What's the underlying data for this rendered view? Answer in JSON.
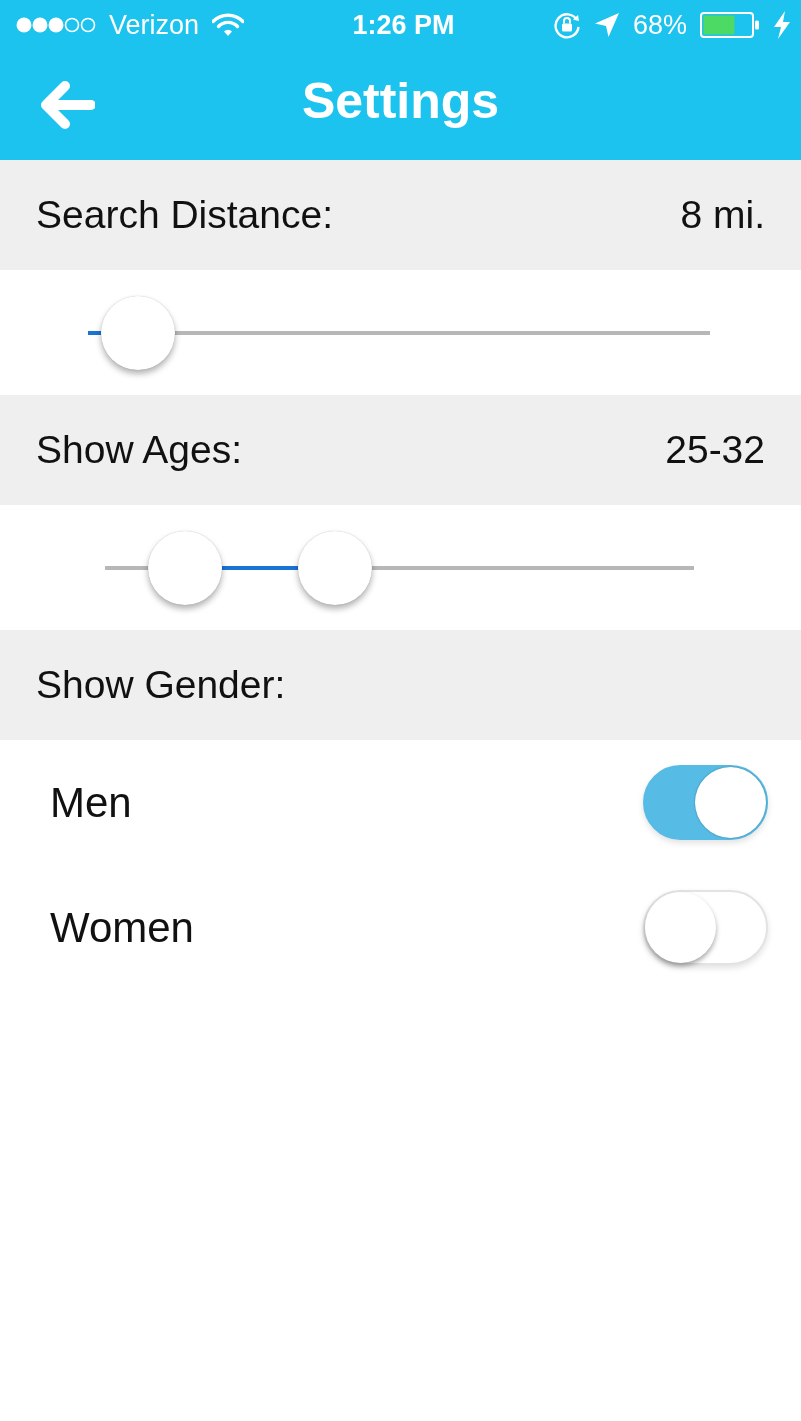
{
  "status_bar": {
    "carrier": "Verizon",
    "time": "1:26 PM",
    "battery": "68%"
  },
  "nav_bar": {
    "title": "Settings"
  },
  "sections": [
    {
      "kind": "slider",
      "label": "Search Distance:",
      "value": "8 mi.",
      "level": 0.08
    },
    {
      "kind": "range",
      "label": "Show Ages:",
      "value": "25-32",
      "thumbs": [
        {
          "level": 0.136
        },
        {
          "level": 0.39
        }
      ]
    },
    {
      "kind": "toggles",
      "label": "Show Gender:",
      "options": [
        {
          "label": "Men",
          "on": true
        },
        {
          "label": "Women",
          "on": false
        }
      ]
    }
  ]
}
